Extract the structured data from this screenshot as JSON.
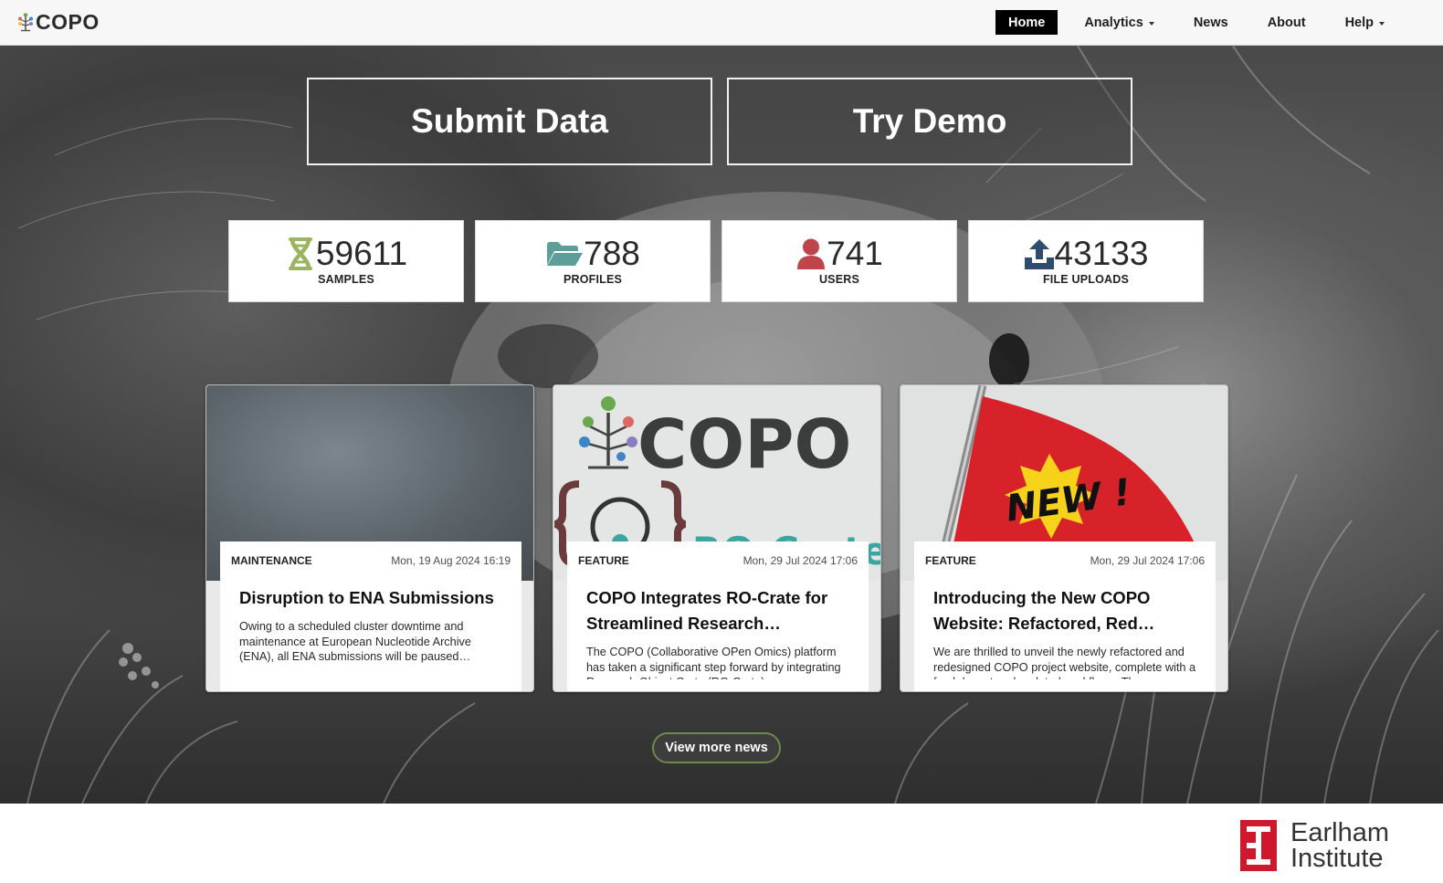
{
  "navbar": {
    "brand": "COPO",
    "items": [
      {
        "label": "Home",
        "active": true,
        "dropdown": false
      },
      {
        "label": "Analytics",
        "active": false,
        "dropdown": true
      },
      {
        "label": "News",
        "active": false,
        "dropdown": false
      },
      {
        "label": "About",
        "active": false,
        "dropdown": false
      },
      {
        "label": "Help",
        "active": false,
        "dropdown": true
      }
    ]
  },
  "hero": {
    "submit_label": "Submit Data",
    "demo_label": "Try Demo"
  },
  "stats": [
    {
      "value": "59611",
      "label": "SAMPLES",
      "icon": "dna-icon",
      "color": "#9bb55f"
    },
    {
      "value": "788",
      "label": "PROFILES",
      "icon": "folder-open-icon",
      "color": "#5e9e98"
    },
    {
      "value": "741",
      "label": "USERS",
      "icon": "user-icon",
      "color": "#c0454b"
    },
    {
      "value": "43133",
      "label": "FILE UPLOADS",
      "icon": "upload-icon",
      "color": "#2d4c6e"
    }
  ],
  "news": [
    {
      "category": "MAINTENANCE",
      "date": "Mon, 19 Aug 2024 16:19",
      "title": "Disruption to ENA Submissions",
      "summary": "Owing to a scheduled cluster downtime and maintenance at European Nucleotide Archive (ENA), all ENA submissions will be paused…"
    },
    {
      "category": "FEATURE",
      "date": "Mon, 29 Jul 2024 17:06",
      "title": "COPO Integrates RO-Crate for Streamlined Research…",
      "summary": "The COPO (Collaborative OPen Omics) platform has taken a significant step forward by integrating Research Object Crate (RO-Crate)…",
      "image_text": "COPO",
      "image_subtext": "RO-Crate"
    },
    {
      "category": "FEATURE",
      "date": "Mon, 29 Jul 2024 17:06",
      "title": "Introducing the New COPO Website: Refactored, Red…",
      "summary": "We are thrilled to unveil the newly refactored and redesigned COPO project website, complete with a fresh layout and updated workflows. The…",
      "image_text": "NEW !"
    }
  ],
  "view_more_label": "View more news",
  "footer": {
    "logo_line1": "Earlham",
    "logo_line2": "Institute"
  },
  "colors": {
    "nav_active_bg": "#000000",
    "earlham_red": "#d0182c",
    "flag_red": "#d8222a",
    "star_yellow": "#f6d21a"
  }
}
